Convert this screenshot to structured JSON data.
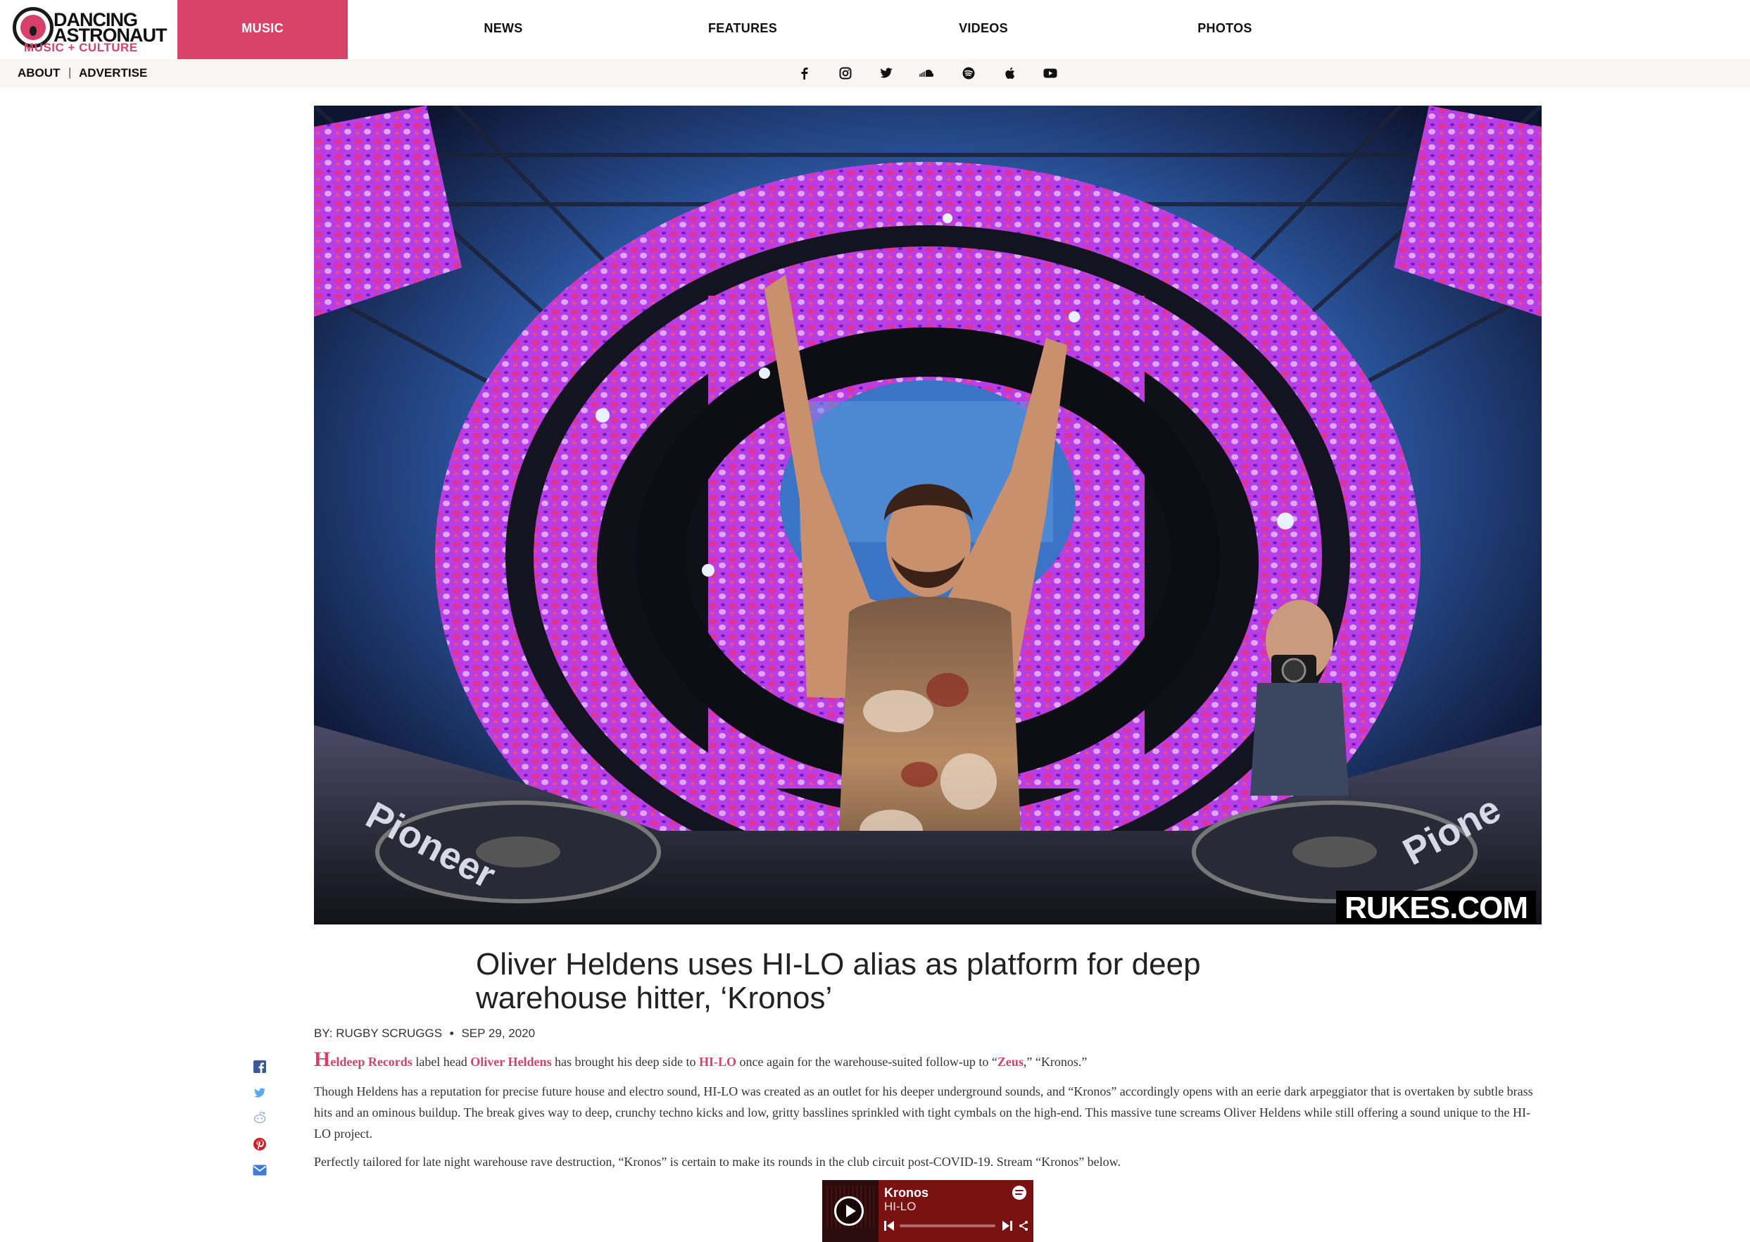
{
  "site": {
    "logo_line1": "DANCING",
    "logo_line2": "ASTRONAUT",
    "logo_tagline": "MUSIC + CULTURE"
  },
  "nav": {
    "items": [
      {
        "label": "MUSIC",
        "active": true
      },
      {
        "label": "NEWS",
        "active": false
      },
      {
        "label": "FEATURES",
        "active": false
      },
      {
        "label": "VIDEOS",
        "active": false
      },
      {
        "label": "PHOTOS",
        "active": false
      }
    ]
  },
  "subnav": {
    "links": [
      "ABOUT",
      "ADVERTISE"
    ],
    "separator": "|",
    "social_icons": [
      "facebook-icon",
      "instagram-icon",
      "twitter-icon",
      "soundcloud-icon",
      "spotify-icon",
      "apple-icon",
      "youtube-icon"
    ]
  },
  "hero": {
    "watermark": "RUKES.COM"
  },
  "article": {
    "headline": "Oliver Heldens uses HI-LO alias as platform for deep warehouse hitter, ‘Kronos’",
    "byline_prefix": "BY:",
    "author": "RUGBY SCRUGGS",
    "date": "SEP 29, 2020",
    "share_icons": [
      "facebook-icon",
      "twitter-icon",
      "reddit-icon",
      "pinterest-icon",
      "email-icon"
    ],
    "p1": {
      "dropcap": "H",
      "link1": "eldeep Records",
      "t1": " label head ",
      "link2": "Oliver Heldens",
      "t2": " has brought his deep side to ",
      "link3": "HI-LO",
      "t3": " once again for the warehouse-suited follow-up to “",
      "link4": "Zeus",
      "t4": ",” “Kronos.”"
    },
    "p2": "Though Heldens has a reputation for precise future house and electro sound, HI-LO was created as an outlet for his deeper underground sounds, and “Kronos” accordingly opens with an eerie dark arpeggiator that is overtaken by subtle brass hits and an ominous buildup. The break gives way to deep, crunchy techno kicks and low, gritty basslines sprinkled with tight cymbals on the high-end. This massive tune screams Oliver Heldens while still offering a sound unique to the HI-LO project.",
    "p3": "Perfectly tailored for late night warehouse rave destruction, “Kronos” is certain to make its rounds in the club circuit post-COVID-19. Stream “Kronos” below."
  },
  "player": {
    "title": "Kronos",
    "artist": "HI-LO",
    "bg_color": "#7a1212"
  },
  "colors": {
    "accent": "#d84468",
    "link": "#d6406a"
  }
}
